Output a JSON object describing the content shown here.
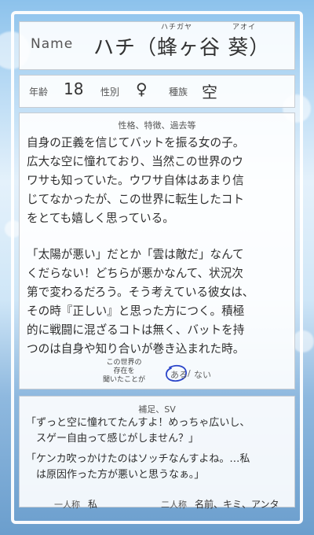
{
  "header": {
    "name_label": "Name",
    "name": "ハチ（蜂ヶ谷 葵）",
    "ruby_surname": "ハチガヤ",
    "ruby_given": "アオイ"
  },
  "stats": {
    "age_label": "年齢",
    "age_value": "18",
    "gender_label": "性別",
    "gender_value": "♀",
    "race_label": "種族",
    "race_value": "空"
  },
  "description": {
    "title": "性格、特徴、過去等",
    "paragraph1": [
      "自身の正義を信じてバットを振る女の子。",
      "広大な空に憧れており、当然この世界のウ",
      "ワサも知っていた。ウワサ自体はあまり信",
      "じてなかったが、この世界に転生したコト",
      "をとても嬉しく思っている。"
    ],
    "paragraph2": [
      "「太陽が悪い」だとか「雲は敵だ」なんて",
      "くだらない！どちらが悪かなんて、状況次",
      "第で変わるだろう。そう考えている彼女は、",
      "その時『正しい』と思った方につく。積極",
      "的に戦闘に混ざるコトは無く、バットを持",
      "つのは自身や知り合いが巻き込まれた時。"
    ],
    "question": [
      "この世界の",
      "存在を",
      "聞いたことが"
    ],
    "answer_yes": "ある",
    "answer_sep": "/",
    "answer_no": "ない"
  },
  "supplement": {
    "title": "補足、SV",
    "quote1": [
      "「ずっと空に憧れてたんすよ！めっちゃ広いし、",
      "　スゲー自由って感じがしません？」"
    ],
    "quote2": [
      "「ケンカ吹っかけたのはソッチなんすよね。…私",
      "　は原因作った方が悪いと思うなぁ。」"
    ],
    "first_person_label": "一人称",
    "first_person_value": "私",
    "second_person_label": "二人称",
    "second_person_value": "名前、キミ、アンタ"
  }
}
